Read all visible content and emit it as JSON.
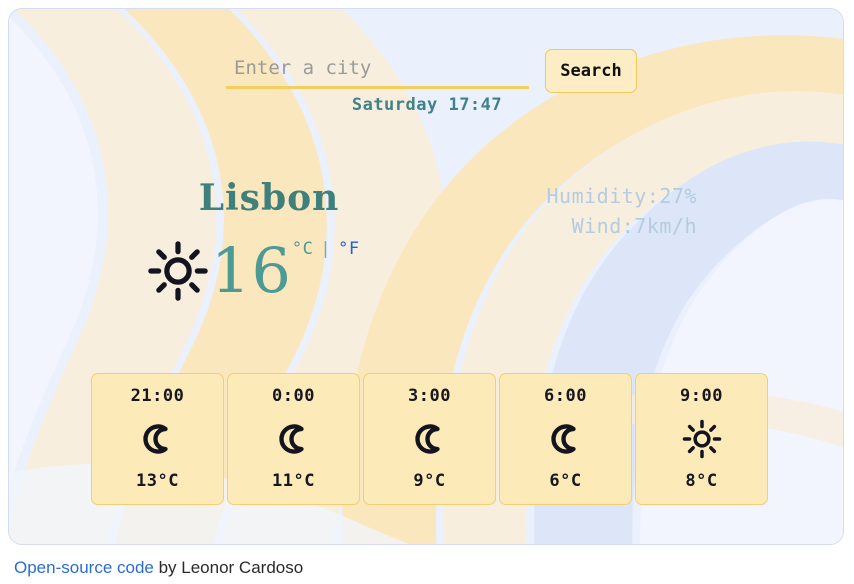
{
  "search": {
    "placeholder": "Enter a city",
    "value": "",
    "button_label": "Search"
  },
  "datetime": "Saturday 17:47",
  "current": {
    "city": "Lisbon",
    "temperature": "16",
    "icon": "sun-icon",
    "unit_celsius": "°C",
    "unit_separator": "|",
    "unit_fahrenheit": "°F",
    "humidity": "Humidity:27%",
    "wind": "Wind:7km/h"
  },
  "forecast": [
    {
      "time": "21:00",
      "icon": "moon-icon",
      "temp": "13°C"
    },
    {
      "time": "0:00",
      "icon": "moon-icon",
      "temp": "11°C"
    },
    {
      "time": "3:00",
      "icon": "moon-icon",
      "temp": "9°C"
    },
    {
      "time": "6:00",
      "icon": "moon-icon",
      "temp": "6°C"
    },
    {
      "time": "9:00",
      "icon": "sun-icon",
      "temp": "8°C"
    }
  ],
  "footer": {
    "link_text": "Open-source code",
    "rest_text": " by Leonor Cardoso"
  },
  "colors": {
    "teal": "#3f7f7c",
    "teal_light": "#4c9a94",
    "gold_border": "#f0c95a",
    "gold_underline": "#f2cf5e",
    "card_yellow": "#fdeab9",
    "button_yellow": "#fdedc4",
    "condition_blue": "#b4cbe0",
    "link_blue": "#2b6cd4",
    "fahrenheit_blue": "#1a5df0",
    "bg_blue": "#eaf0fc",
    "wave_blue": "#dce6f8",
    "wave_pale": "#f2f5fd",
    "wave_cream": "#f7eedd",
    "wave_yellow": "#fae7be",
    "icon_dark": "#141420"
  }
}
